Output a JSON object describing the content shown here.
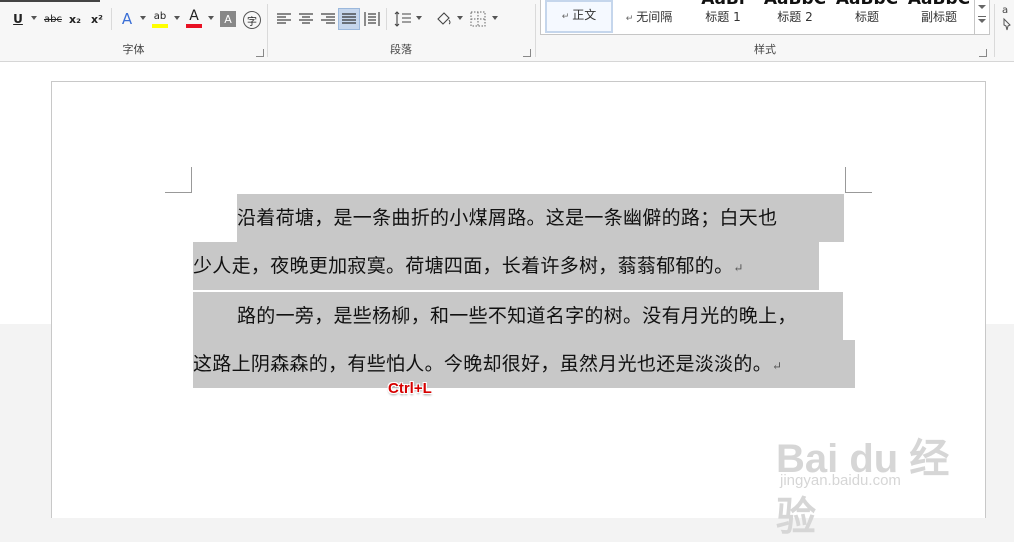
{
  "ribbon": {
    "font_group": {
      "label": "字体",
      "buttons": {
        "underline": "U",
        "strikethrough": "abc",
        "subscript": "x₂",
        "superscript": "x²",
        "text_effects": "A",
        "highlight": "ab",
        "font_color": "A",
        "char_shading": "A",
        "enclose": "字"
      },
      "highlight_color": "#ffff00",
      "font_color_value": "#e81123"
    },
    "paragraph_group": {
      "label": "段落"
    },
    "styles_group": {
      "label": "样式",
      "items": [
        "正文",
        "无间隔",
        "标题 1",
        "标题 2",
        "标题",
        "副标题"
      ],
      "previews": [
        "",
        "",
        "AaBl",
        "AaBbC",
        "AaBbC",
        "AaBbC"
      ],
      "selected": "正文"
    }
  },
  "document": {
    "lines": [
      "沿着荷塘，是一条曲折的小煤屑路。这是一条幽僻的路；白天也",
      "少人走，夜晚更加寂寞。荷塘四面，长着许多树，蓊蓊郁郁的。",
      "路的一旁，是些杨柳，和一些不知道名字的树。没有月光的晚上，",
      "这路上阴森森的，有些怕人。今晚却很好，虽然月光也还是淡淡的。"
    ],
    "paragraph_mark": "↵",
    "selection_color": "#c8c8c8"
  },
  "annotation": {
    "shortcut": "Ctrl+L",
    "color": "#d60000"
  },
  "watermark": {
    "brand": "Bai du 经验",
    "url": "jingyan.baidu.com"
  }
}
